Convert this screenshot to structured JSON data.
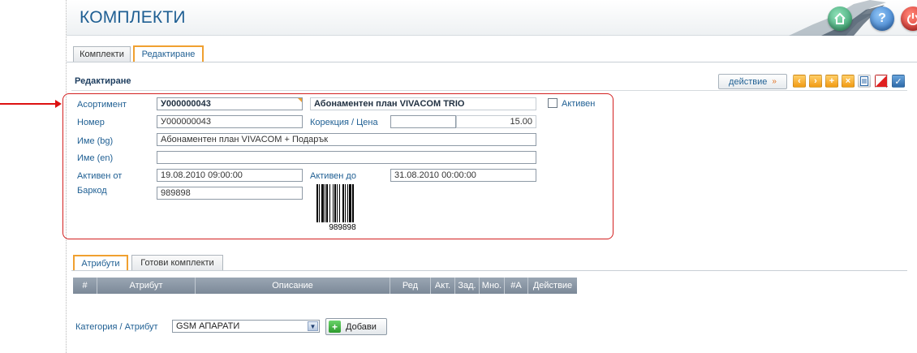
{
  "header": {
    "title": "КОМПЛЕКТИ",
    "home_icon": "home-icon",
    "help_label": "?",
    "power_icon": "power-icon"
  },
  "tabs": [
    {
      "label": "Комплекти",
      "active": false
    },
    {
      "label": "Редактиране",
      "active": true
    }
  ],
  "section": {
    "title": "Редактиране",
    "action_label": "действие",
    "action_arrow": "»"
  },
  "toolbar": {
    "icons": [
      "arrow-left-icon",
      "arrow-right-icon",
      "add-icon",
      "delete-icon",
      "document-icon",
      "cancel-icon",
      "save-check-icon"
    ],
    "prev": "‹",
    "next": "›",
    "add": "+",
    "delete": "×",
    "save": "✓"
  },
  "form": {
    "assortment_label": "Асортимент",
    "assortment_code": "У000000043",
    "assortment_name": "Абонаментен план VIVACOM TRIO",
    "active_label": "Активен",
    "active_checked": false,
    "number_label": "Номер",
    "number_value": "У000000043",
    "correction_label": "Корекция / Цена",
    "correction_value": "",
    "price_value": "15.00",
    "name_bg_label": "Име (bg)",
    "name_bg_value": "Абонаментен план VIVACOM + Подарък",
    "name_en_label": "Име (en)",
    "name_en_value": "",
    "active_from_label": "Активен от",
    "active_from_value": "19.08.2010 09:00:00",
    "active_to_label": "Активен до",
    "active_to_value": "31.08.2010 00:00:00",
    "barcode_label": "Баркод",
    "barcode_value": "989898",
    "barcode_caption": "989898"
  },
  "subtabs": [
    {
      "label": "Атрибути",
      "active": true
    },
    {
      "label": "Готови комплекти",
      "active": false
    }
  ],
  "grid": {
    "columns": [
      "#",
      "Атрибут",
      "Описание",
      "Ред",
      "Акт.",
      "Зад.",
      "Мно.",
      "#А",
      "Действие"
    ]
  },
  "category": {
    "label": "Категория / Атрибут",
    "selected": "GSM АПАРАТИ",
    "add_label": "Добави"
  },
  "colors": {
    "title_blue": "#1f5f93",
    "annotation_red": "#d32020",
    "tab_orange": "#f0a030"
  }
}
